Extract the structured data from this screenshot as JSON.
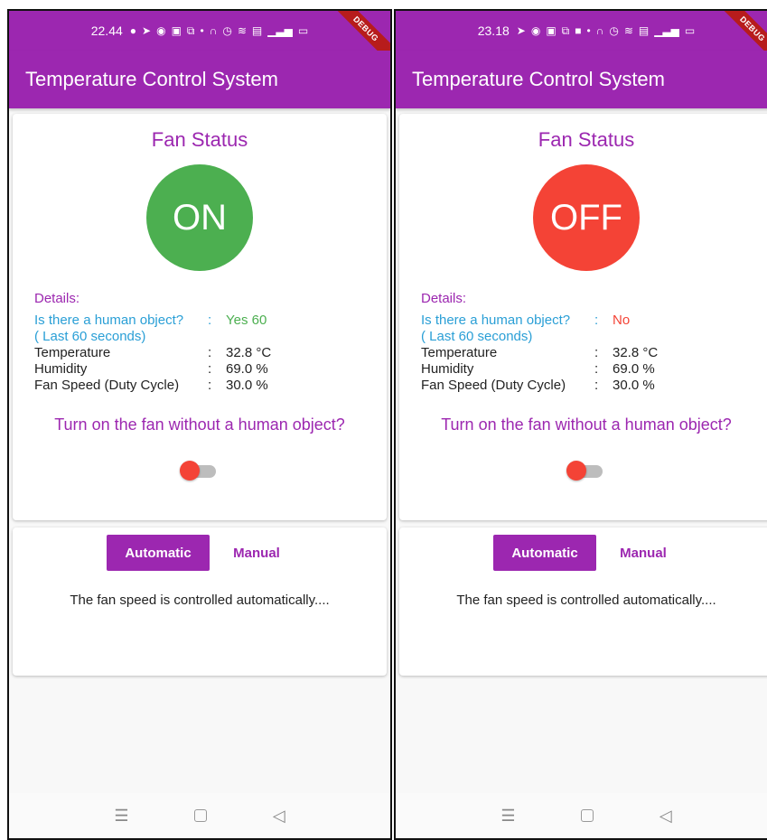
{
  "phones": [
    {
      "status_time": "22.44",
      "debug_label": "DEBUG",
      "app_title": "Temperature Control System",
      "fan_status_title": "Fan Status",
      "fan_state": "ON",
      "details_label": "Details:",
      "human_question": "Is there a human object?",
      "human_sub": "( Last 60 seconds)",
      "human_answer": "Yes 60",
      "temperature_label": "Temperature",
      "temperature_value": "32.8 °C",
      "humidity_label": "Humidity",
      "humidity_value": "69.0 %",
      "fan_speed_label": "Fan Speed (Duty Cycle)",
      "fan_speed_value": "30.0 %",
      "separator": ":",
      "toggle_question": "Turn on the fan without a human object?",
      "btn_automatic": "Automatic",
      "btn_manual": "Manual",
      "mode_description": "The fan speed is controlled automatically...."
    },
    {
      "status_time": "23.18",
      "debug_label": "DEBUG",
      "app_title": "Temperature Control System",
      "fan_status_title": "Fan Status",
      "fan_state": "OFF",
      "details_label": "Details:",
      "human_question": "Is there a human object?",
      "human_sub": "( Last 60 seconds)",
      "human_answer": "No",
      "temperature_label": "Temperature",
      "temperature_value": "32.8 °C",
      "humidity_label": "Humidity",
      "humidity_value": "69.0 %",
      "fan_speed_label": "Fan Speed (Duty Cycle)",
      "fan_speed_value": "30.0 %",
      "separator": ":",
      "toggle_question": "Turn on the fan without a human object?",
      "btn_automatic": "Automatic",
      "btn_manual": "Manual",
      "mode_description": "The fan speed is controlled automatically...."
    }
  ],
  "colors": {
    "primary": "#9c27b0",
    "fan_on": "#4caf50",
    "fan_off": "#f44336",
    "human_text": "#2a9fd6"
  },
  "icons": {
    "status_bar": [
      "whatsapp-icon",
      "telegram-icon",
      "location-icon",
      "app-icon",
      "cast-icon",
      "dot-icon",
      "headset-icon",
      "alarm-icon",
      "vibrate-icon",
      "volte-icon",
      "signal-icon",
      "signal-icon-2",
      "battery-icon"
    ],
    "nav": [
      "menu-icon",
      "home-icon",
      "back-icon"
    ]
  }
}
